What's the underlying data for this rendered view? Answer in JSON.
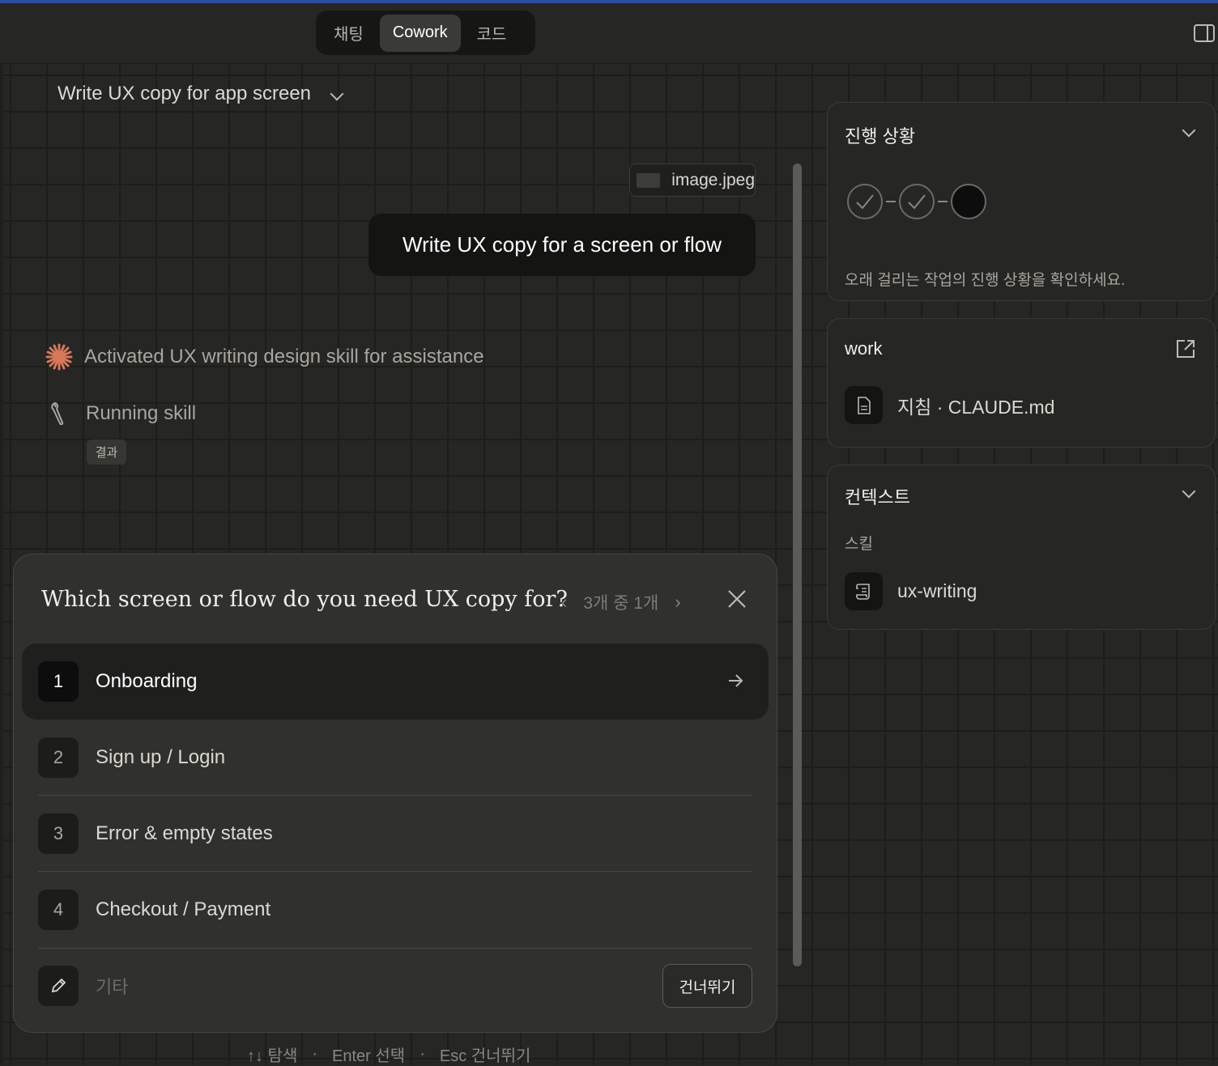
{
  "mode_tabs": [
    {
      "label": "채팅",
      "active": false
    },
    {
      "label": "Cowork",
      "active": true
    },
    {
      "label": "코드",
      "active": false
    }
  ],
  "conversation": {
    "title": "Write UX copy for app screen",
    "attachment": "image.jpeg",
    "user_message": "Write UX copy for a screen or flow",
    "activity": "Activated UX writing design skill for assistance",
    "running": "Running skill",
    "result_chip": "결과"
  },
  "question": {
    "title": "Which screen or flow do you need UX copy for?",
    "pager": "3개 중 1개",
    "options": [
      {
        "num": "1",
        "label": "Onboarding"
      },
      {
        "num": "2",
        "label": "Sign up / Login"
      },
      {
        "num": "3",
        "label": "Error & empty states"
      },
      {
        "num": "4",
        "label": "Checkout / Payment"
      }
    ],
    "other_placeholder": "기타",
    "skip_label": "건너뛰기"
  },
  "hints": {
    "navigate": "↑↓ 탐색",
    "select": "Enter 선택",
    "skip": "Esc 건너뛰기",
    "separator": "·"
  },
  "progress_panel": {
    "title": "진행 상황",
    "steps": [
      "done",
      "done",
      "pending"
    ],
    "note": "오래 걸리는 작업의 진행 상황을 확인하세요."
  },
  "work_panel": {
    "title": "work",
    "file": "지침 · CLAUDE.md"
  },
  "context_panel": {
    "title": "컨텍스트",
    "section": "스킬",
    "skill": "ux-writing"
  },
  "colors": {
    "accent_burst": "#d9775a",
    "background": "#262624"
  }
}
